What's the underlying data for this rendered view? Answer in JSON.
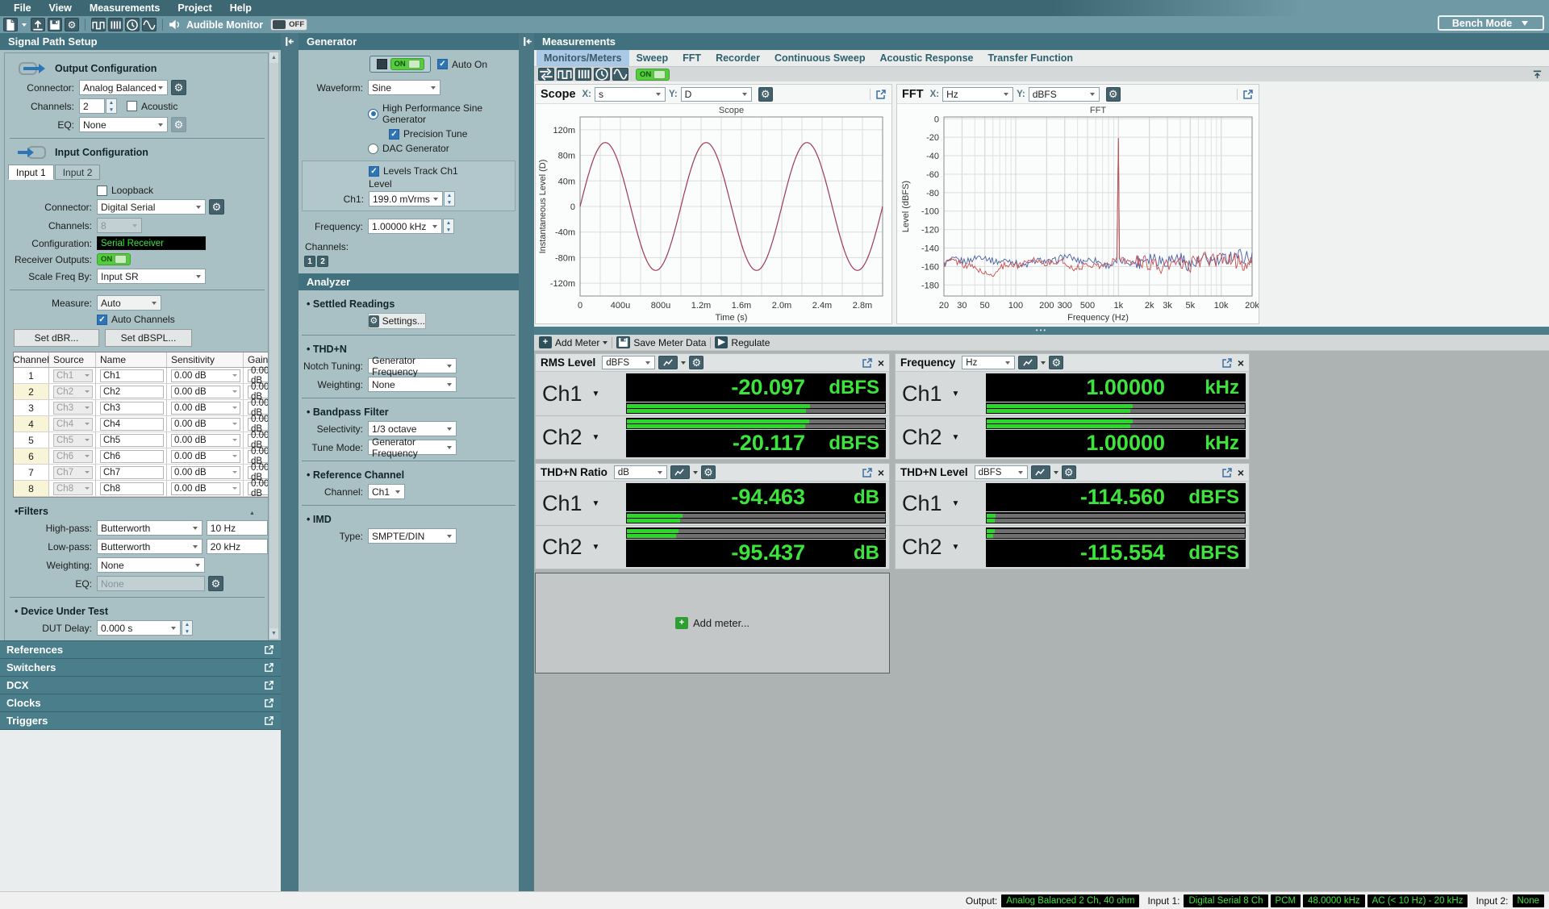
{
  "icons": {
    "gear": "⚙",
    "caret": "▾",
    "popout": "↗",
    "close": "×",
    "play": "▶",
    "plus": "+",
    "dots": "•••",
    "up": "▲",
    "down": "▼",
    "check": "✓"
  },
  "menu": {
    "items": [
      "File",
      "View",
      "Measurements",
      "Project",
      "Help"
    ]
  },
  "toolbar": {
    "audible_monitor_label": "Audible Monitor",
    "audible_monitor_state": "OFF",
    "bench_mode_label": "Bench Mode"
  },
  "signal_path": {
    "title": "Signal Path Setup",
    "output_config": {
      "title": "Output Configuration",
      "connector_label": "Connector:",
      "connector": "Analog Balanced",
      "channels_label": "Channels:",
      "channels": "2",
      "acoustic_label": "Acoustic",
      "eq_label": "EQ:",
      "eq": "None"
    },
    "input_config": {
      "title": "Input Configuration",
      "tabs": [
        "Input 1",
        "Input 2"
      ],
      "loopback_label": "Loopback",
      "connector_label": "Connector:",
      "connector": "Digital Serial",
      "channels_label": "Channels:",
      "channels": "8",
      "configuration_label": "Configuration:",
      "configuration": "Serial Receiver",
      "receiver_outputs_label": "Receiver Outputs:",
      "receiver_outputs_state": "ON",
      "scale_freq_label": "Scale Freq By:",
      "scale_freq": "Input SR"
    },
    "measure": {
      "measure_label": "Measure:",
      "measure": "Auto",
      "auto_channels_label": "Auto Channels",
      "set_dbr_label": "Set dBR...",
      "set_dbspl_label": "Set dBSPL...",
      "table": {
        "headers": [
          "Channel",
          "Source",
          "Name",
          "Sensitivity",
          "Gain"
        ],
        "rows": [
          {
            "channel": "1",
            "source": "Ch1",
            "name": "Ch1",
            "sensitivity": "0.00 dB",
            "gain": "0.00 dB"
          },
          {
            "channel": "2",
            "source": "Ch2",
            "name": "Ch2",
            "sensitivity": "0.00 dB",
            "gain": "0.00 dB"
          },
          {
            "channel": "3",
            "source": "Ch3",
            "name": "Ch3",
            "sensitivity": "0.00 dB",
            "gain": "0.00 dB"
          },
          {
            "channel": "4",
            "source": "Ch4",
            "name": "Ch4",
            "sensitivity": "0.00 dB",
            "gain": "0.00 dB"
          },
          {
            "channel": "5",
            "source": "Ch5",
            "name": "Ch5",
            "sensitivity": "0.00 dB",
            "gain": "0.00 dB"
          },
          {
            "channel": "6",
            "source": "Ch6",
            "name": "Ch6",
            "sensitivity": "0.00 dB",
            "gain": "0.00 dB"
          },
          {
            "channel": "7",
            "source": "Ch7",
            "name": "Ch7",
            "sensitivity": "0.00 dB",
            "gain": "0.00 dB"
          },
          {
            "channel": "8",
            "source": "Ch8",
            "name": "Ch8",
            "sensitivity": "0.00 dB",
            "gain": "0.00 dB"
          }
        ]
      }
    },
    "filters": {
      "title": "Filters",
      "highpass_label": "High-pass:",
      "highpass": "Butterworth",
      "highpass_value": "10 Hz",
      "lowpass_label": "Low-pass:",
      "lowpass": "Butterworth",
      "lowpass_value": "20 kHz",
      "weighting_label": "Weighting:",
      "weighting": "None",
      "eq_label": "EQ:",
      "eq": "None"
    },
    "dut": {
      "title": "Device Under Test",
      "delay_label": "DUT Delay:",
      "delay": "0.000 s"
    },
    "collapsed_sections": [
      "References",
      "Switchers",
      "DCX",
      "Clocks",
      "Triggers"
    ]
  },
  "generator": {
    "title": "Generator",
    "on_label": "ON",
    "auto_on_label": "Auto On",
    "waveform_label": "Waveform:",
    "waveform": "Sine",
    "hp_sine_label": "High Performance Sine Generator",
    "precision_tune_label": "Precision Tune",
    "dac_label": "DAC Generator",
    "levels_track_label": "Levels Track Ch1",
    "level_label": "Level",
    "ch1_label": "Ch1:",
    "ch1_level": "199.0 mVrms",
    "frequency_label": "Frequency:",
    "frequency": "1.00000 kHz",
    "channels_label": "Channels:",
    "channel_buttons": [
      "1",
      "2"
    ]
  },
  "analyzer": {
    "title": "Analyzer",
    "settled": {
      "title": "Settled Readings",
      "settings_label": "Settings..."
    },
    "thdn": {
      "title": "THD+N",
      "notch_label": "Notch Tuning:",
      "notch": "Generator Frequency",
      "weighting_label": "Weighting:",
      "weighting": "None"
    },
    "bandpass": {
      "title": "Bandpass Filter",
      "selectivity_label": "Selectivity:",
      "selectivity": "1/3 octave",
      "tune_label": "Tune Mode:",
      "tune": "Generator Frequency"
    },
    "reference": {
      "title": "Reference Channel",
      "channel_label": "Channel:",
      "channel": "Ch1"
    },
    "imd": {
      "title": "IMD",
      "type_label": "Type:",
      "type": "SMPTE/DIN"
    }
  },
  "measurements": {
    "title": "Measurements",
    "tabs": [
      {
        "label": "Monitors/Meters",
        "selected": true
      },
      {
        "label": "Sweep",
        "selected": false
      },
      {
        "label": "FFT",
        "selected": false
      },
      {
        "label": "Recorder",
        "selected": false
      },
      {
        "label": "Continuous Sweep",
        "selected": false
      },
      {
        "label": "Acoustic Response",
        "selected": false
      },
      {
        "label": "Transfer Function",
        "selected": false
      }
    ],
    "on_label": "ON",
    "meter_toolbar": {
      "add_meter": "Add Meter",
      "save": "Save Meter Data",
      "regulate": "Regulate"
    },
    "add_meter_placeholder": "Add meter...",
    "meters": [
      {
        "title": "RMS Level",
        "unit": "dBFS",
        "channels": [
          {
            "name": "Ch1",
            "value": "-20.097",
            "unit": "dBFS",
            "bars": [
              0.71,
              0.695
            ]
          },
          {
            "name": "Ch2",
            "value": "-20.117",
            "unit": "dBFS",
            "bars": [
              0.705,
              0.69
            ]
          }
        ]
      },
      {
        "title": "Frequency",
        "unit": "Hz",
        "channels": [
          {
            "name": "Ch1",
            "value": "1.00000",
            "unit": "kHz",
            "bars": [
              0.565,
              0.555
            ]
          },
          {
            "name": "Ch2",
            "value": "1.00000",
            "unit": "kHz",
            "bars": [
              0.565,
              0.555
            ]
          }
        ]
      },
      {
        "title": "THD+N Ratio",
        "unit": "dB",
        "channels": [
          {
            "name": "Ch1",
            "value": "-94.463",
            "unit": "dB",
            "bars": [
              0.215,
              0.205
            ]
          },
          {
            "name": "Ch2",
            "value": "-95.437",
            "unit": "dB",
            "bars": [
              0.2,
              0.19
            ]
          }
        ]
      },
      {
        "title": "THD+N Level",
        "unit": "dBFS",
        "channels": [
          {
            "name": "Ch1",
            "value": "-114.560",
            "unit": "dBFS",
            "bars": [
              0.035,
              0.03
            ]
          },
          {
            "name": "Ch2",
            "value": "-115.554",
            "unit": "dBFS",
            "bars": [
              0.03,
              0.025
            ]
          }
        ]
      }
    ]
  },
  "chart_data": [
    {
      "type": "line",
      "panel_title": "Scope",
      "chart_title": "Scope",
      "x_control_label": "X:",
      "x_control": "s",
      "y_control_label": "Y:",
      "y_control": "D",
      "xlabel": "Time (s)",
      "ylabel": "Instantaneous Level (D)",
      "x_ticks": [
        "0",
        "400u",
        "800u",
        "1.2m",
        "1.6m",
        "2.0m",
        "2.4m",
        "2.8m"
      ],
      "x_tick_values": [
        0,
        0.0004,
        0.0008,
        0.0012,
        0.0016,
        0.002,
        0.0024,
        0.0028
      ],
      "x_range": [
        0,
        0.003
      ],
      "y_ticks": [
        "120m",
        "80m",
        "40m",
        "0",
        "-40m",
        "-80m",
        "-120m"
      ],
      "y_tick_values": [
        0.12,
        0.08,
        0.04,
        0,
        -0.04,
        -0.08,
        -0.12
      ],
      "y_range": [
        -0.14,
        0.14
      ],
      "signal": {
        "shape": "sine",
        "amplitude": 0.1,
        "frequency_hz": 1000
      },
      "series_color": "#9c3a52",
      "grid": true
    },
    {
      "type": "line",
      "panel_title": "FFT",
      "chart_title": "FFT",
      "x_control_label": "X:",
      "x_control": "Hz",
      "y_control_label": "Y:",
      "y_control": "dBFS",
      "xlabel": "Frequency (Hz)",
      "ylabel": "Level (dBFS)",
      "x_scale": "log",
      "x_ticks": [
        "20",
        "30",
        "50",
        "100",
        "200",
        "300",
        "500",
        "1k",
        "2k",
        "3k",
        "5k",
        "10k",
        "20k"
      ],
      "x_tick_values": [
        20,
        30,
        50,
        100,
        200,
        300,
        500,
        1000,
        2000,
        3000,
        5000,
        10000,
        20000
      ],
      "x_range": [
        20,
        20000
      ],
      "y_ticks": [
        "0",
        "-20",
        "-40",
        "-60",
        "-80",
        "-100",
        "-120",
        "-140",
        "-160",
        "-180"
      ],
      "y_tick_values": [
        0,
        -20,
        -40,
        -60,
        -80,
        -100,
        -120,
        -140,
        -160,
        -180
      ],
      "y_range": [
        -192,
        2
      ],
      "series": [
        {
          "name": "Ch1",
          "color": "#4a5fa5",
          "noise_floor_dbfs": -154,
          "peak": {
            "freq_hz": 1000,
            "level_dbfs": -21
          }
        },
        {
          "name": "Ch2",
          "color": "#c94f4f",
          "noise_floor_dbfs": -157,
          "peak": {
            "freq_hz": 1000,
            "level_dbfs": -21
          }
        }
      ],
      "grid": true
    }
  ],
  "status_bar": {
    "output_label": "Output:",
    "output_value": "Analog Balanced 2 Ch, 40 ohm",
    "input1_label": "Input 1:",
    "input1_values": [
      "Digital Serial 8 Ch",
      "PCM",
      "48.0000 kHz",
      "AC (< 10 Hz) - 20 kHz"
    ],
    "input2_label": "Input 2:",
    "input2_value": "None"
  },
  "colors": {
    "accent_blue": "#2e75b6",
    "led_green": "#3ce43c",
    "bar_green": "#2dd52d",
    "header_teal": "#41717e",
    "tab_selected": "#a9c9e7",
    "scope_trace": "#9c3a52",
    "fft_trace_ch1": "#4a5fa5",
    "fft_trace_ch2": "#c94f4f"
  }
}
